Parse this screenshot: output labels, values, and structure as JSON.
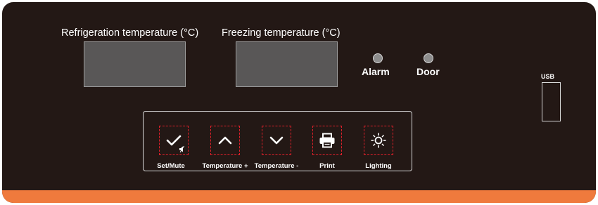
{
  "displays": {
    "refrigeration_label": "Refrigeration temperature (°C)",
    "freezing_label": "Freezing temperature (°C)"
  },
  "indicators": {
    "alarm_label": "Alarm",
    "door_label": "Door"
  },
  "usb": {
    "label": "USB"
  },
  "keypad": {
    "set_mute_label": "Set/Mute",
    "temp_up_label": "Temperature +",
    "temp_down_label": "Temperature -",
    "print_label": "Print",
    "lighting_label": "Lighting"
  },
  "icons": {
    "set": "check-icon",
    "mute": "speaker-muted-icon",
    "up": "chevron-up-icon",
    "down": "chevron-down-icon",
    "print": "printer-icon",
    "lighting": "lightbulb-icon"
  },
  "colors": {
    "panel": "#231815",
    "accent_strip": "#ef7a3d",
    "key_border": "#e0202a",
    "display": "#595757",
    "led": "#8d8d8d"
  }
}
